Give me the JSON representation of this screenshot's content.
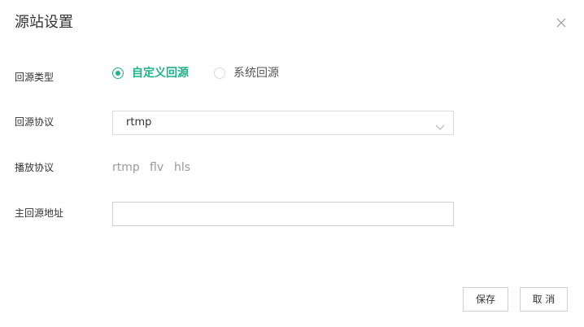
{
  "dialog": {
    "title": "源站设置"
  },
  "form": {
    "origin_type": {
      "label": "回源类型",
      "options": [
        {
          "label": "自定义回源",
          "checked": true
        },
        {
          "label": "系统回源",
          "checked": false
        }
      ]
    },
    "origin_protocol": {
      "label": "回源协议",
      "selected": "rtmp"
    },
    "playback_protocol": {
      "label": "播放协议",
      "values": [
        "rtmp",
        "flv",
        "hls"
      ]
    },
    "primary_origin": {
      "label": "主回源地址",
      "value": "",
      "placeholder": ""
    }
  },
  "footer": {
    "save_label": "保存",
    "cancel_label": "取 消"
  },
  "colors": {
    "accent": "#20b28c",
    "muted_text": "#9a9a9a",
    "border": "#dcdcdc"
  },
  "icons": {
    "close": "close-icon",
    "dropdown": "chevron-down-icon"
  }
}
